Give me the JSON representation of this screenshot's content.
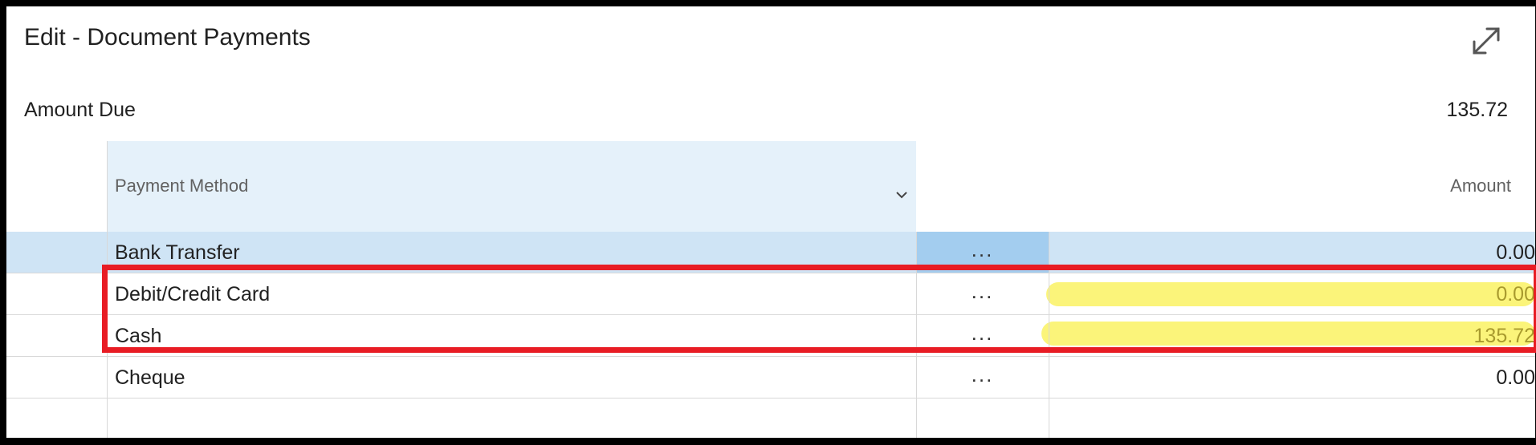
{
  "dialog": {
    "title": "Edit - Document Payments",
    "expand_icon": "expand-icon"
  },
  "amount_due": {
    "label": "Amount Due",
    "value": "135.72"
  },
  "grid": {
    "columns": {
      "payment_method": "Payment Method",
      "amount": "Amount"
    },
    "menu_glyph": "...",
    "rows": [
      {
        "method": "Bank Transfer",
        "amount": "0.00",
        "selected": true
      },
      {
        "method": "Debit/Credit Card",
        "amount": "0.00",
        "highlighted": true
      },
      {
        "method": "Cash",
        "amount": "135.72",
        "highlighted": true
      },
      {
        "method": "Cheque",
        "amount": "0.00"
      }
    ]
  },
  "colors": {
    "header_bg": "#e5f1fa",
    "selected_row_bg": "#cfe4f5",
    "menu_cell_selected_bg": "#a3cdef",
    "highlighter": "#fbf47a",
    "annotation_red": "#e81c24"
  }
}
